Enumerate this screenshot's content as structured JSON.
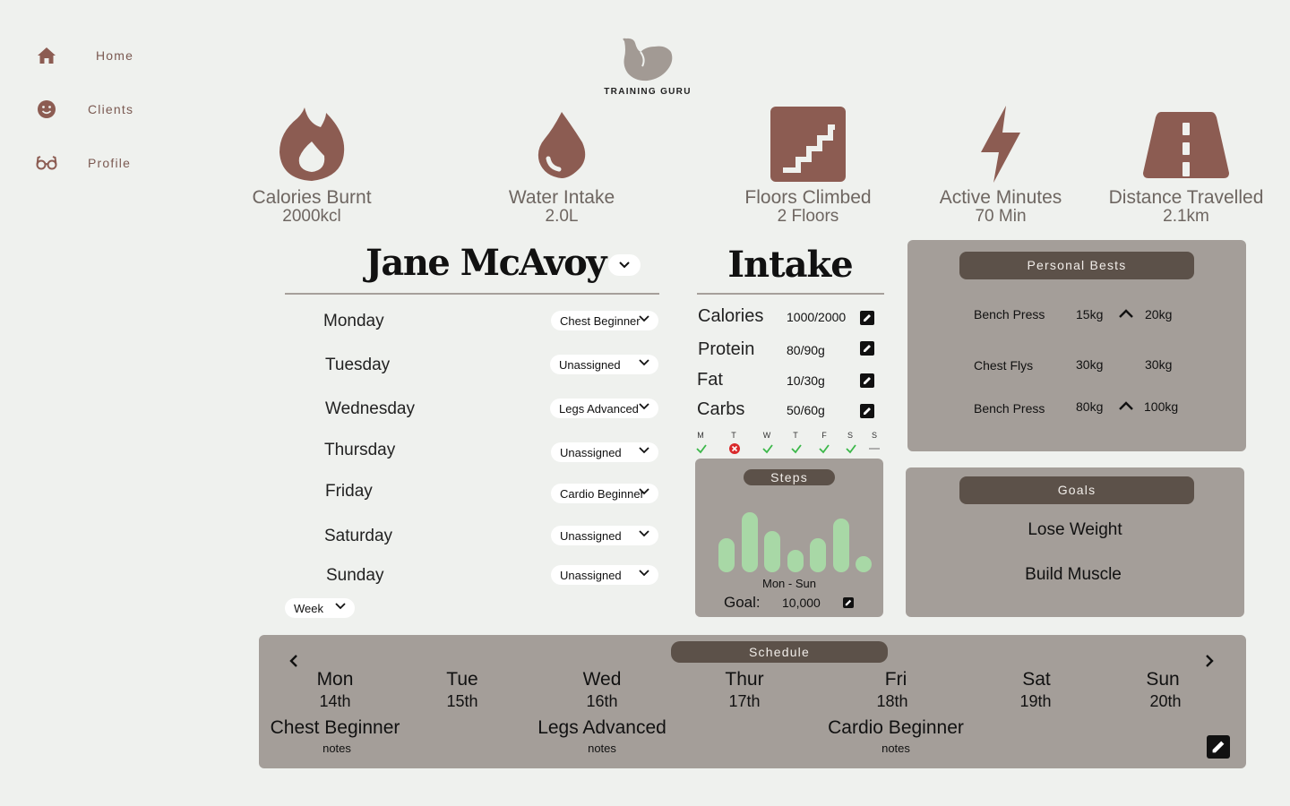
{
  "nav": {
    "items": [
      {
        "label": "Home",
        "icon": "home-icon"
      },
      {
        "label": "Clients",
        "icon": "smiley-icon"
      },
      {
        "label": "Profile",
        "icon": "glasses-icon"
      }
    ]
  },
  "logo": {
    "text": "TRAINING GURU",
    "icon": "flexed-arm-icon"
  },
  "stats": [
    {
      "label": "Calories Burnt",
      "value": "2000kcl",
      "icon": "flame-icon"
    },
    {
      "label": "Water Intake",
      "value": "2.0L",
      "icon": "water-drop-icon"
    },
    {
      "label": "Floors Climbed",
      "value": "2 Floors",
      "icon": "stairs-icon"
    },
    {
      "label": "Active Minutes",
      "value": "70 Min",
      "icon": "lightning-icon"
    },
    {
      "label": "Distance Travelled",
      "value": "2.1km",
      "icon": "road-icon"
    }
  ],
  "client": {
    "name": "Jane McAvoy",
    "days": [
      {
        "day": "Monday",
        "workout": "Chest Beginner"
      },
      {
        "day": "Tuesday",
        "workout": "Unassigned"
      },
      {
        "day": "Wednesday",
        "workout": "Legs Advanced"
      },
      {
        "day": "Thursday",
        "workout": "Unassigned"
      },
      {
        "day": "Friday",
        "workout": "Cardio Beginner"
      },
      {
        "day": "Saturday",
        "workout": "Unassigned"
      },
      {
        "day": "Sunday",
        "workout": "Unassigned"
      }
    ],
    "period": "Week"
  },
  "intake": {
    "title": "Intake",
    "rows": [
      {
        "label": "Calories",
        "value": "1000/2000"
      },
      {
        "label": "Protein",
        "value": "80/90g"
      },
      {
        "label": "Fat",
        "value": "10/30g"
      },
      {
        "label": "Carbs",
        "value": "50/60g"
      }
    ],
    "week": [
      {
        "letter": "M",
        "status": "done"
      },
      {
        "letter": "T",
        "status": "missed"
      },
      {
        "letter": "W",
        "status": "done"
      },
      {
        "letter": "T",
        "status": "done"
      },
      {
        "letter": "F",
        "status": "done"
      },
      {
        "letter": "S",
        "status": "done"
      },
      {
        "letter": "S",
        "status": "none"
      }
    ]
  },
  "steps": {
    "title": "Steps",
    "range": "Mon - Sun",
    "goal_label": "Goal:",
    "goal_value": "10,000",
    "bar_color": "#a8d8a6",
    "daily_fraction": [
      0.45,
      0.8,
      0.55,
      0.3,
      0.45,
      0.72,
      0.1
    ]
  },
  "personal_bests": {
    "title": "Personal Bests",
    "rows": [
      {
        "exercise": "Bench Press",
        "previous": "15kg",
        "current": "20kg",
        "improved": true
      },
      {
        "exercise": "Chest Flys",
        "previous": "30kg",
        "current": "30kg",
        "improved": false
      },
      {
        "exercise": "Bench Press",
        "previous": "80kg",
        "current": "100kg",
        "improved": true
      }
    ]
  },
  "goals": {
    "title": "Goals",
    "items": [
      "Lose Weight",
      "Build Muscle"
    ]
  },
  "schedule": {
    "title": "Schedule",
    "days": [
      {
        "day": "Mon",
        "date": "14th",
        "workout": "Chest Beginner",
        "notes": "notes"
      },
      {
        "day": "Tue",
        "date": "15th",
        "workout": "",
        "notes": ""
      },
      {
        "day": "Wed",
        "date": "16th",
        "workout": "Legs Advanced",
        "notes": "notes"
      },
      {
        "day": "Thur",
        "date": "17th",
        "workout": "",
        "notes": ""
      },
      {
        "day": "Fri",
        "date": "18th",
        "workout": "Cardio Beginner",
        "notes": "notes"
      },
      {
        "day": "Sat",
        "date": "19th",
        "workout": "",
        "notes": ""
      },
      {
        "day": "Sun",
        "date": "20th",
        "workout": "",
        "notes": ""
      }
    ]
  },
  "colors": {
    "accent": "#8c5c52",
    "panel": "#a49e99",
    "panel_header": "#5c5149",
    "background": "#eff1ee",
    "check": "#3cb84a",
    "missed": "#d9292b"
  }
}
